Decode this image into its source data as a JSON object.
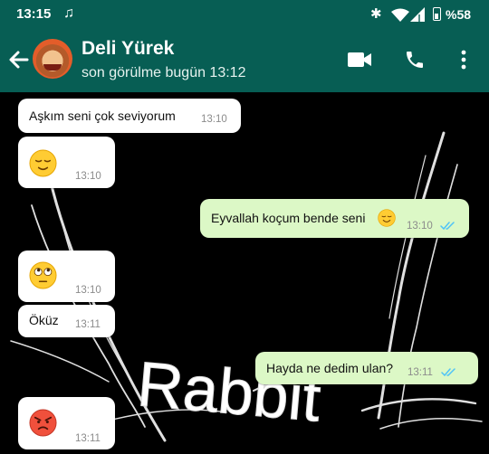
{
  "status_bar": {
    "time": "13:15",
    "music_icon": "♫",
    "bluetooth_icon": "✱",
    "battery_text": "%58"
  },
  "header": {
    "contact_name": "Deli Yürek",
    "last_seen": "son görülme bugün 13:12"
  },
  "wallpaper": {
    "text": "Rabbit"
  },
  "messages": [
    {
      "direction": "in",
      "text": "Aşkım seni çok seviyorum",
      "time": "13:10"
    },
    {
      "direction": "in",
      "text": "",
      "emoji": "relieved-face",
      "time": "13:10"
    },
    {
      "direction": "out",
      "text": "Eyvallah koçum bende seni",
      "emoji": "smiling-face",
      "time": "13:10",
      "read": true
    },
    {
      "direction": "in",
      "text": "",
      "emoji": "eye-roll-face",
      "time": "13:10"
    },
    {
      "direction": "in",
      "text": "Öküz",
      "time": "13:11"
    },
    {
      "direction": "out",
      "text": "Hayda ne dedim ulan?",
      "time": "13:11",
      "read": true
    },
    {
      "direction": "in",
      "text": "",
      "emoji": "angry-face",
      "time": "13:11"
    }
  ],
  "colors": {
    "header": "#075E54",
    "incoming": "#ffffff",
    "outgoing": "#dcf8c6",
    "read_ticks": "#4fc3f7"
  }
}
